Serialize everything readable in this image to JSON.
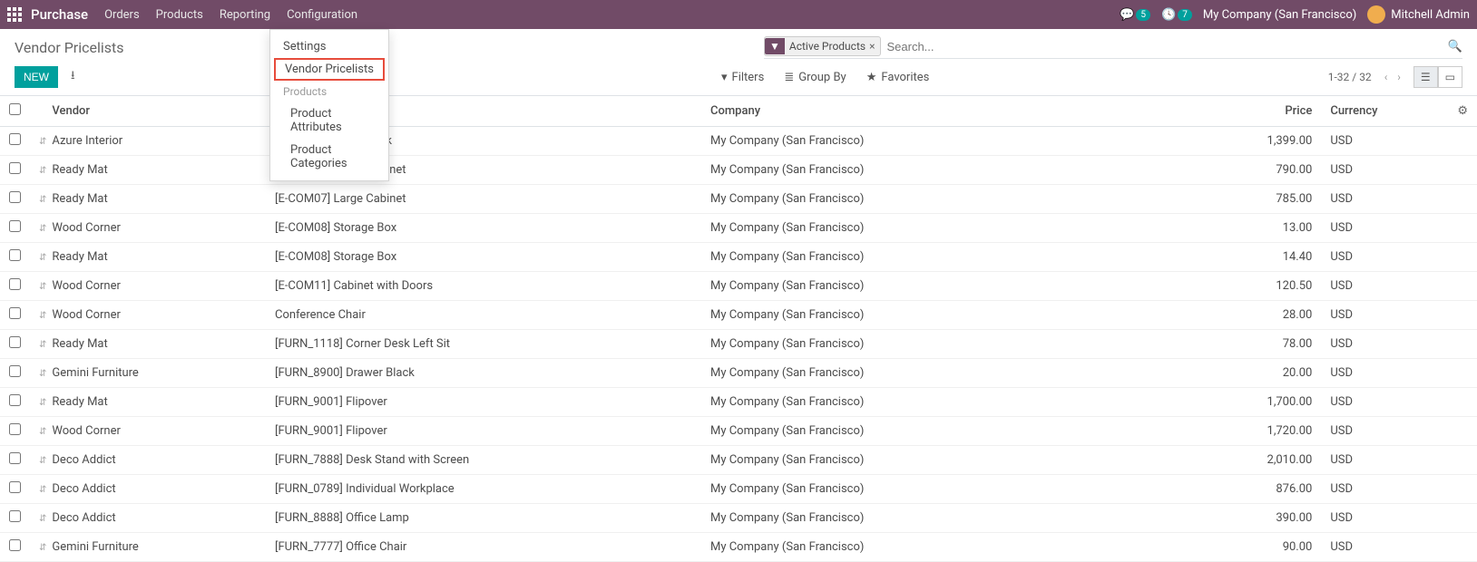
{
  "nav": {
    "brand": "Purchase",
    "items": [
      "Orders",
      "Products",
      "Reporting",
      "Configuration"
    ],
    "chat_badge": "5",
    "clock_badge": "7",
    "company": "My Company (San Francisco)",
    "user": "Mitchell Admin"
  },
  "page": {
    "title": "Vendor Pricelists",
    "facet": "Active Products",
    "search_placeholder": "Search...",
    "new_btn": "NEW",
    "filters": "Filters",
    "groupby": "Group By",
    "favorites": "Favorites",
    "pager": "1-32 / 32"
  },
  "dropdown": {
    "settings": "Settings",
    "vendor_pricelists": "Vendor Pricelists",
    "products_header": "Products",
    "product_attributes": "Product Attributes",
    "product_categories": "Product Categories"
  },
  "cols": {
    "vendor": "Vendor",
    "company": "Company",
    "price": "Price",
    "currency": "Currency"
  },
  "rows": [
    {
      "vendor": "Azure Interior",
      "product": "[E-COM09] Large Desk",
      "company": "My Company (San Francisco)",
      "price": "1,399.00",
      "currency": "USD"
    },
    {
      "vendor": "Ready Mat",
      "product": "[E-COM07] Large Cabinet",
      "company": "My Company (San Francisco)",
      "price": "790.00",
      "currency": "USD"
    },
    {
      "vendor": "Ready Mat",
      "product": "[E-COM07] Large Cabinet",
      "company": "My Company (San Francisco)",
      "price": "785.00",
      "currency": "USD"
    },
    {
      "vendor": "Wood Corner",
      "product": "[E-COM08] Storage Box",
      "company": "My Company (San Francisco)",
      "price": "13.00",
      "currency": "USD"
    },
    {
      "vendor": "Ready Mat",
      "product": "[E-COM08] Storage Box",
      "company": "My Company (San Francisco)",
      "price": "14.40",
      "currency": "USD"
    },
    {
      "vendor": "Wood Corner",
      "product": "[E-COM11] Cabinet with Doors",
      "company": "My Company (San Francisco)",
      "price": "120.50",
      "currency": "USD"
    },
    {
      "vendor": "Wood Corner",
      "product": "Conference Chair",
      "company": "My Company (San Francisco)",
      "price": "28.00",
      "currency": "USD"
    },
    {
      "vendor": "Ready Mat",
      "product": "[FURN_1118] Corner Desk Left Sit",
      "company": "My Company (San Francisco)",
      "price": "78.00",
      "currency": "USD"
    },
    {
      "vendor": "Gemini Furniture",
      "product": "[FURN_8900] Drawer Black",
      "company": "My Company (San Francisco)",
      "price": "20.00",
      "currency": "USD"
    },
    {
      "vendor": "Ready Mat",
      "product": "[FURN_9001] Flipover",
      "company": "My Company (San Francisco)",
      "price": "1,700.00",
      "currency": "USD"
    },
    {
      "vendor": "Wood Corner",
      "product": "[FURN_9001] Flipover",
      "company": "My Company (San Francisco)",
      "price": "1,720.00",
      "currency": "USD"
    },
    {
      "vendor": "Deco Addict",
      "product": "[FURN_7888] Desk Stand with Screen",
      "company": "My Company (San Francisco)",
      "price": "2,010.00",
      "currency": "USD"
    },
    {
      "vendor": "Deco Addict",
      "product": "[FURN_0789] Individual Workplace",
      "company": "My Company (San Francisco)",
      "price": "876.00",
      "currency": "USD"
    },
    {
      "vendor": "Deco Addict",
      "product": "[FURN_8888] Office Lamp",
      "company": "My Company (San Francisco)",
      "price": "390.00",
      "currency": "USD"
    },
    {
      "vendor": "Gemini Furniture",
      "product": "[FURN_7777] Office Chair",
      "company": "My Company (San Francisco)",
      "price": "90.00",
      "currency": "USD"
    }
  ]
}
